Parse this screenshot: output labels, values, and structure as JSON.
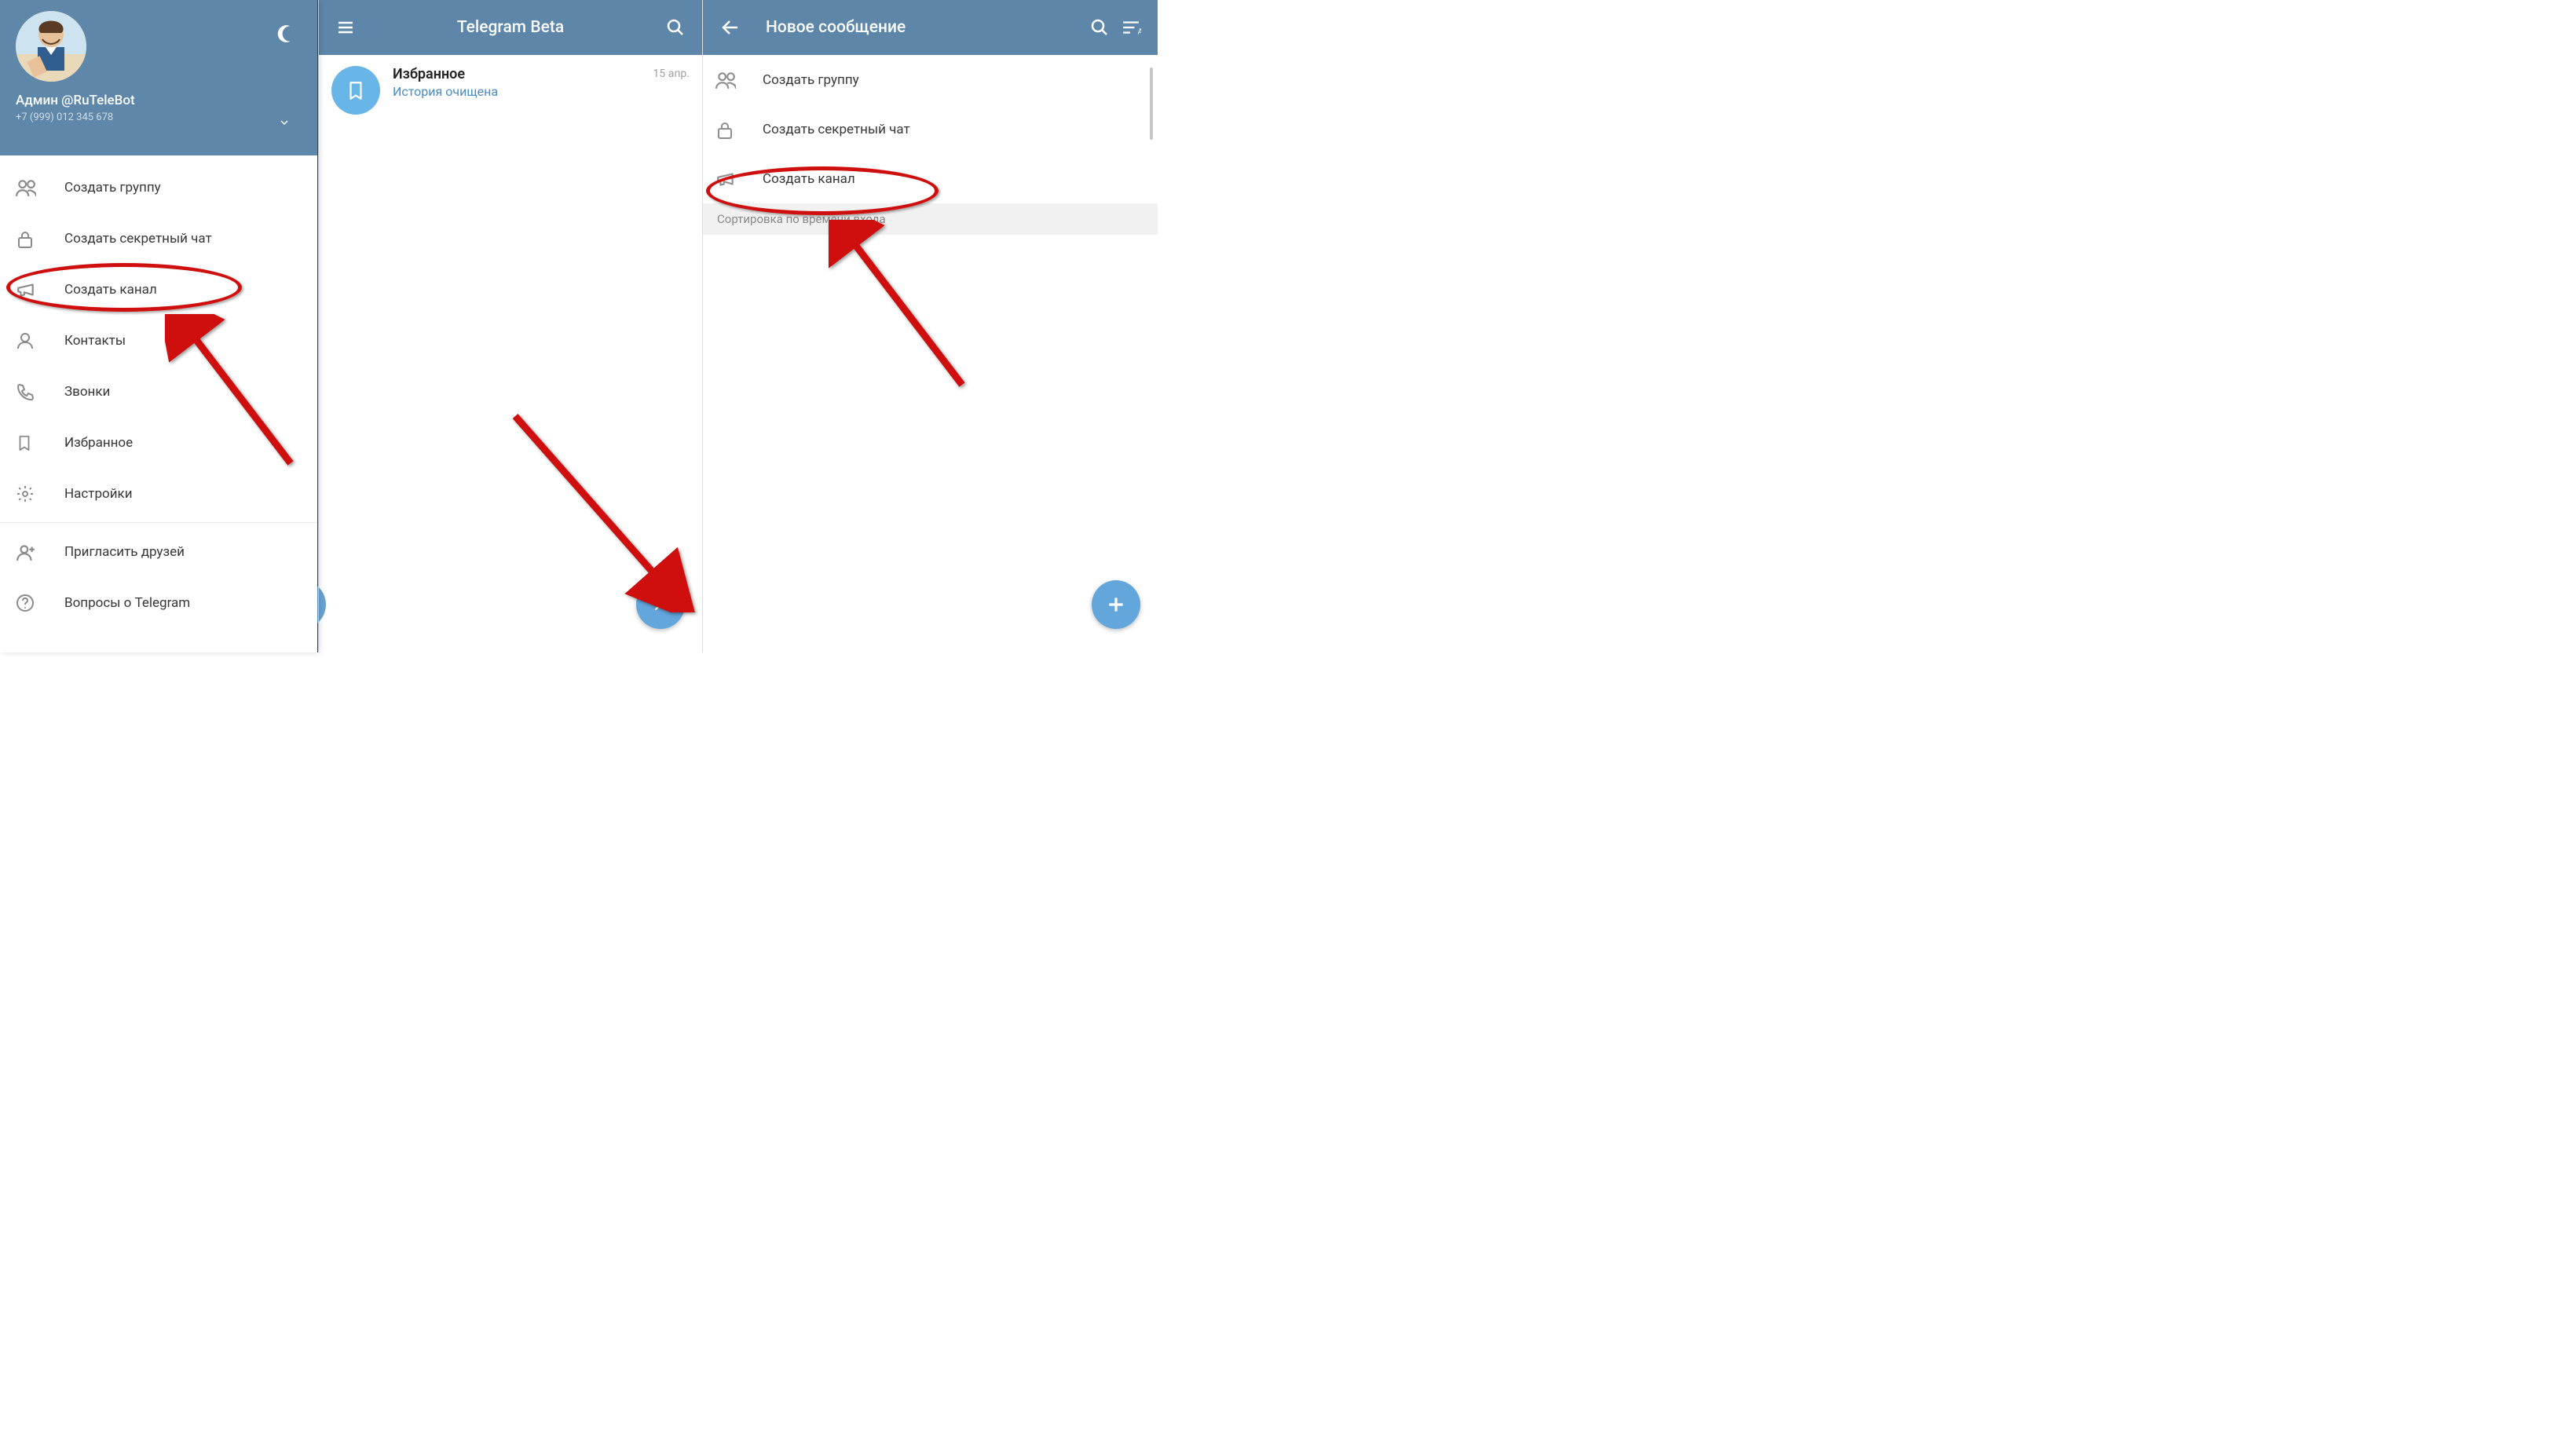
{
  "panel1": {
    "profile": {
      "name": "Админ @RuTeleBot",
      "phone": "+7 (999) 012 345 678"
    },
    "peek_date": "15 апр.",
    "menu": [
      {
        "icon": "group-icon",
        "label": "Создать группу"
      },
      {
        "icon": "lock-icon",
        "label": "Создать секретный чат"
      },
      {
        "icon": "megaphone-icon",
        "label": "Создать канал"
      },
      {
        "icon": "contact-icon",
        "label": "Контакты"
      },
      {
        "icon": "phone-icon",
        "label": "Звонки"
      },
      {
        "icon": "bookmark-icon",
        "label": "Избранное"
      },
      {
        "icon": "gear-icon",
        "label": "Настройки"
      },
      {
        "icon": "invite-icon",
        "label": "Пригласить друзей"
      },
      {
        "icon": "help-icon",
        "label": "Вопросы о Telegram"
      }
    ]
  },
  "panel2": {
    "title": "Telegram Beta",
    "saved": {
      "title": "Избранное",
      "subtitle": "История очищена",
      "date": "15 апр."
    }
  },
  "panel3": {
    "title": "Новое сообщение",
    "options": [
      {
        "icon": "group-icon",
        "label": "Создать группу"
      },
      {
        "icon": "lock-icon",
        "label": "Создать секретный чат"
      },
      {
        "icon": "megaphone-icon",
        "label": "Создать канал"
      }
    ],
    "sort_header": "Сортировка по времени входа"
  }
}
